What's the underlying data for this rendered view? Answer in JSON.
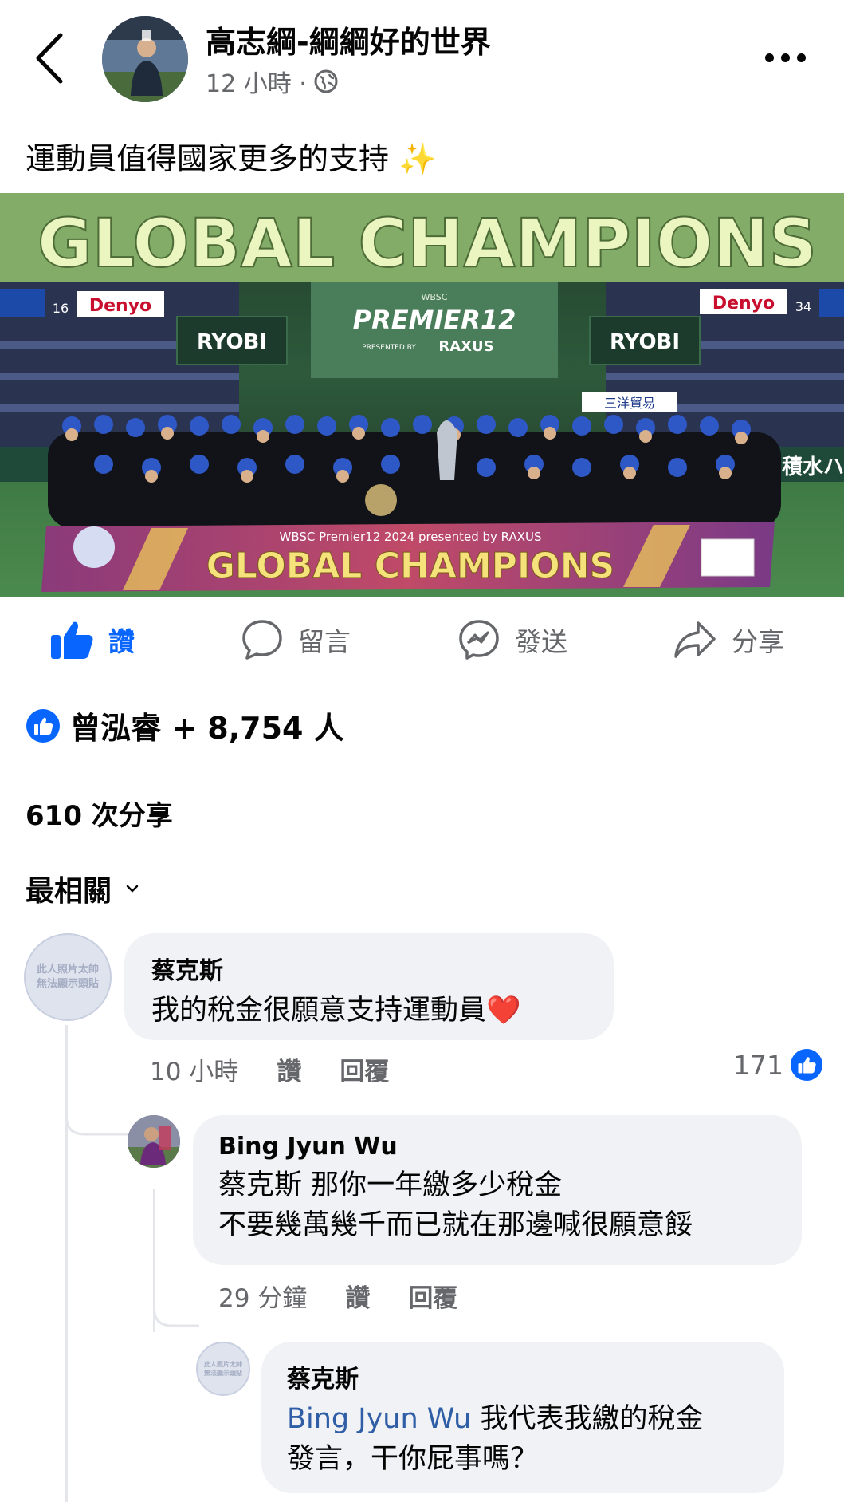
{
  "header": {
    "author": "高志綱-綱綱好的世界",
    "time": "12 小時 ·",
    "audience_icon": "globe-icon"
  },
  "post": {
    "caption": "運動員值得國家更多的支持 ✨",
    "image": {
      "top_banner": "GLOBAL CHAMPIONS",
      "center_logo": "PREMIER12",
      "wbsc_small": "WBSC",
      "sponsor": "RAXUS",
      "presented_by": "PRESENTED BY",
      "board_left": "RYOBI",
      "board_right": "RYOBI",
      "ad_left": "Denyo",
      "ad_right": "Denyo",
      "banner_subtitle": "WBSC Premier12 2024 presented by RAXUS",
      "banner_title": "GLOBAL CHAMPIONS",
      "wall_right": "積水ハ",
      "wall_sign": "三洋貿易",
      "seat_number_left": "16",
      "seat_number_right": "34"
    }
  },
  "actions": {
    "like": "讚",
    "comment": "留言",
    "send": "發送",
    "share": "分享"
  },
  "reactions": {
    "summary": "曾泓睿 + 8,754 人"
  },
  "shares": "610 次分享",
  "sort": {
    "label": "最相關"
  },
  "comments": [
    {
      "avatar_text": "此人照片太帥無法顯示頭貼",
      "name": "蔡克斯",
      "text": "我的稅金很願意支持運動員",
      "heart": "❤️",
      "time": "10 小時",
      "like": "讚",
      "reply": "回覆",
      "reaction_count": "171"
    },
    {
      "name": "Bing Jyun Wu",
      "line1": "蔡克斯 那你一年繳多少稅金",
      "line2": "不要幾萬幾千而已就在那邊喊很願意餒",
      "time": "29 分鐘",
      "like": "讚",
      "reply": "回覆"
    },
    {
      "avatar_text": "此人照片太帥無法顯示頭貼",
      "name": "蔡克斯",
      "mention": "Bing Jyun Wu",
      "line1_rest": " 我代表我繳的稅金",
      "line2": "發言，干你屁事嗎？"
    }
  ],
  "colors": {
    "accent": "#0866ff",
    "secondary_text": "#65676b",
    "bubble": "#f0f2f5"
  }
}
